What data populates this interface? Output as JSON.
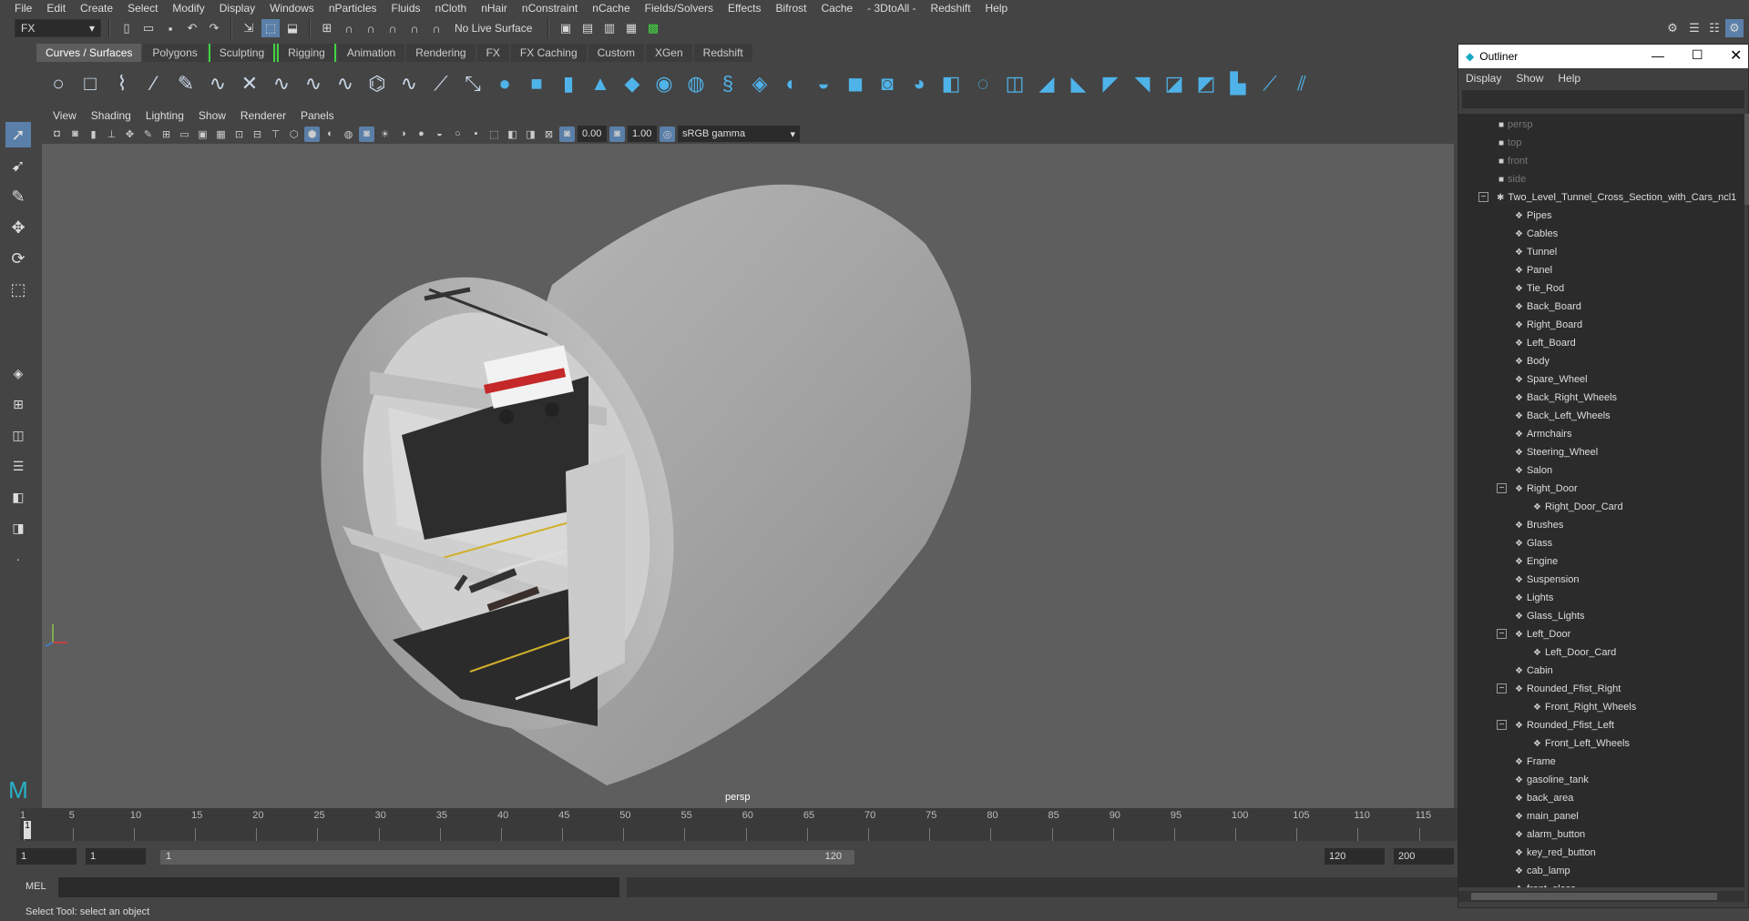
{
  "menubar": [
    "File",
    "Edit",
    "Create",
    "Select",
    "Modify",
    "Display",
    "Windows",
    "nParticles",
    "Fluids",
    "nCloth",
    "nHair",
    "nConstraint",
    "nCache",
    "Fields/Solvers",
    "Effects",
    "Bifrost",
    "Cache",
    "- 3DtoAll -",
    "Redshift",
    "Help"
  ],
  "statusline": {
    "mode": "FX",
    "live_surface": "No Live Surface"
  },
  "shelf_tabs": [
    "Curves / Surfaces",
    "Polygons",
    "Sculpting",
    "Rigging",
    "Animation",
    "Rendering",
    "FX",
    "FX Caching",
    "Custom",
    "XGen",
    "Redshift"
  ],
  "viewport": {
    "menu": [
      "View",
      "Shading",
      "Lighting",
      "Show",
      "Renderer",
      "Panels"
    ],
    "exposure": "0.00",
    "gamma": "1.00",
    "colorspace": "sRGB gamma",
    "camera_label": "persp"
  },
  "timeline": {
    "ticks": [
      "1",
      "5",
      "10",
      "15",
      "20",
      "25",
      "30",
      "35",
      "40",
      "45",
      "50",
      "55",
      "60",
      "65",
      "70",
      "75",
      "80",
      "85",
      "90",
      "95",
      "100",
      "105",
      "110",
      "115"
    ],
    "current": "1"
  },
  "range": {
    "start": "1",
    "start2": "1",
    "slider_start": "1",
    "slider_end": "120",
    "end": "120",
    "end2": "200"
  },
  "cmdline": {
    "lang": "MEL"
  },
  "helpline": "Select Tool: select an object",
  "outliner": {
    "title": "Outliner",
    "menu": [
      "Display",
      "Show",
      "Help"
    ],
    "cameras": [
      "persp",
      "top",
      "front",
      "side"
    ],
    "root": "Two_Level_Tunnel_Cross_Section_with_Cars_ncl1",
    "items": [
      {
        "label": "Pipes",
        "level": 1
      },
      {
        "label": "Cables",
        "level": 1
      },
      {
        "label": "Tunnel",
        "level": 1
      },
      {
        "label": "Panel",
        "level": 1
      },
      {
        "label": "Tie_Rod",
        "level": 1
      },
      {
        "label": "Back_Board",
        "level": 1
      },
      {
        "label": "Right_Board",
        "level": 1
      },
      {
        "label": "Left_Board",
        "level": 1
      },
      {
        "label": "Body",
        "level": 1
      },
      {
        "label": "Spare_Wheel",
        "level": 1
      },
      {
        "label": "Back_Right_Wheels",
        "level": 1
      },
      {
        "label": "Back_Left_Wheels",
        "level": 1
      },
      {
        "label": "Armchairs",
        "level": 1
      },
      {
        "label": "Steering_Wheel",
        "level": 1
      },
      {
        "label": "Salon",
        "level": 1
      },
      {
        "label": "Right_Door",
        "level": 1,
        "expanded": true
      },
      {
        "label": "Right_Door_Card",
        "level": 2
      },
      {
        "label": "Brushes",
        "level": 1
      },
      {
        "label": "Glass",
        "level": 1
      },
      {
        "label": "Engine",
        "level": 1
      },
      {
        "label": "Suspension",
        "level": 1
      },
      {
        "label": "Lights",
        "level": 1
      },
      {
        "label": "Glass_Lights",
        "level": 1
      },
      {
        "label": "Left_Door",
        "level": 1,
        "expanded": true
      },
      {
        "label": "Left_Door_Card",
        "level": 2
      },
      {
        "label": "Cabin",
        "level": 1
      },
      {
        "label": "Rounded_Ffist_Right",
        "level": 1,
        "expanded": true
      },
      {
        "label": "Front_Right_Wheels",
        "level": 2
      },
      {
        "label": "Rounded_Ffist_Left",
        "level": 1,
        "expanded": true
      },
      {
        "label": "Front_Left_Wheels",
        "level": 2
      },
      {
        "label": "Frame",
        "level": 1
      },
      {
        "label": "gasoline_tank",
        "level": 1
      },
      {
        "label": "back_area",
        "level": 1
      },
      {
        "label": "main_panel",
        "level": 1
      },
      {
        "label": "alarm_button",
        "level": 1
      },
      {
        "label": "key_red_button",
        "level": 1
      },
      {
        "label": "cab_lamp",
        "level": 1
      },
      {
        "label": "front_glass",
        "level": 1
      }
    ]
  }
}
